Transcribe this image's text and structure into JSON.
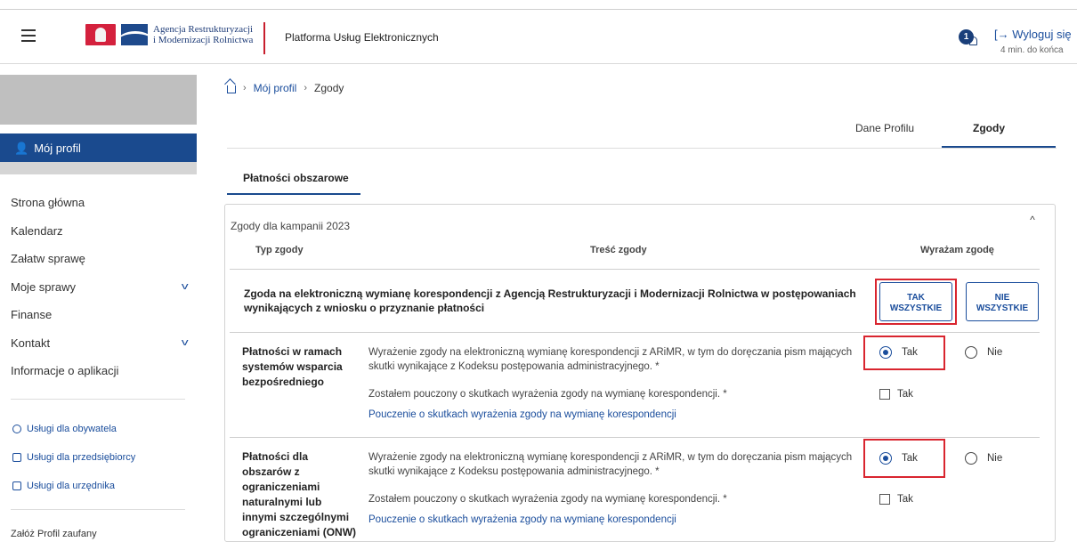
{
  "header": {
    "logo_line1": "Agencja Restrukturyzacji",
    "logo_line2": "i Modernizacji Rolnictwa",
    "platform": "Platforma Usług Elektronicznych",
    "notif_count": "1",
    "logout": "Wyloguj się",
    "timer": "4 min. do końca"
  },
  "sidebar": {
    "active": "Mój profil",
    "items": [
      "Strona główna",
      "Kalendarz",
      "Załatw sprawę",
      "Moje sprawy",
      "Finanse",
      "Kontakt",
      "Informacje o aplikacji"
    ],
    "services": [
      "Usługi dla obywatela",
      "Usługi dla przedsiębiorcy",
      "Usługi dla urzędnika"
    ],
    "bottom": "Załóż Profil zaufany"
  },
  "breadcrumb": {
    "profile": "Mój profil",
    "current": "Zgody"
  },
  "profile_tabs": [
    "Dane Profilu",
    "Zgody"
  ],
  "subtab": "Płatności obszarowe",
  "campaign": {
    "title": "Zgody dla kampanii 2023",
    "col_type": "Typ zgody",
    "col_content": "Treść zgody",
    "col_consent": "Wyrażam zgodę"
  },
  "global_consent": {
    "text": "Zgoda na elektroniczną wymianę korespondencji z Agencją Restrukturyzacji i Modernizacji Rolnictwa w postępowaniach wynikających z wniosku o przyznanie płatności",
    "yes_all_1": "TAK",
    "yes_all_2": "WSZYSTKIE",
    "no_all_1": "NIE",
    "no_all_2": "WSZYSTKIE"
  },
  "sections": [
    {
      "title": "Płatności w ramach systemów wsparcia bezpośredniego",
      "consent_text": "Wyrażenie zgody na elektroniczną wymianę korespondencji z ARiMR, w tym do doręczania pism mających skutki wynikające z Kodeksu postępowania administracyjnego. *",
      "informed_text": "Zostałem pouczony o skutkach wyrażenia zgody na wymianę korespondencji. *",
      "link": "Pouczenie o skutkach wyrażenia zgody na wymianę korespondencji",
      "yes": "Tak",
      "no": "Nie",
      "check": "Tak"
    },
    {
      "title": "Płatności dla obszarów z ograniczeniami naturalnymi lub innymi szczególnymi ograniczeniami (ONW)",
      "consent_text": "Wyrażenie zgody na elektroniczną wymianę korespondencji z ARiMR, w tym do doręczania pism mających skutki wynikające z Kodeksu postępowania administracyjnego. *",
      "informed_text": "Zostałem pouczony o skutkach wyrażenia zgody na wymianę korespondencji. *",
      "link": "Pouczenie o skutkach wyrażenia zgody na wymianę korespondencji",
      "yes": "Tak",
      "no": "Nie",
      "check": "Tak"
    }
  ]
}
